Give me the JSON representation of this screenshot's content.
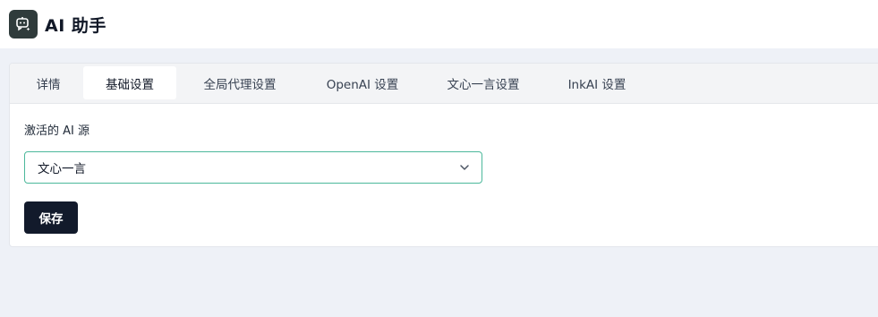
{
  "app": {
    "title": "AI 助手",
    "logo_icon": "robot-sparkle-icon"
  },
  "tabs": [
    {
      "label": "详情",
      "active": false
    },
    {
      "label": "基础设置",
      "active": true
    },
    {
      "label": "全局代理设置",
      "active": false
    },
    {
      "label": "OpenAI 设置",
      "active": false
    },
    {
      "label": "文心一言设置",
      "active": false
    },
    {
      "label": "InkAI 设置",
      "active": false
    }
  ],
  "form": {
    "active_source_label": "激活的 AI 源",
    "active_source_value": "文心一言",
    "save_label": "保存"
  },
  "colors": {
    "accent_border": "#4cb89b",
    "button_bg": "#121a2b",
    "page_bg": "#eef1f7"
  }
}
